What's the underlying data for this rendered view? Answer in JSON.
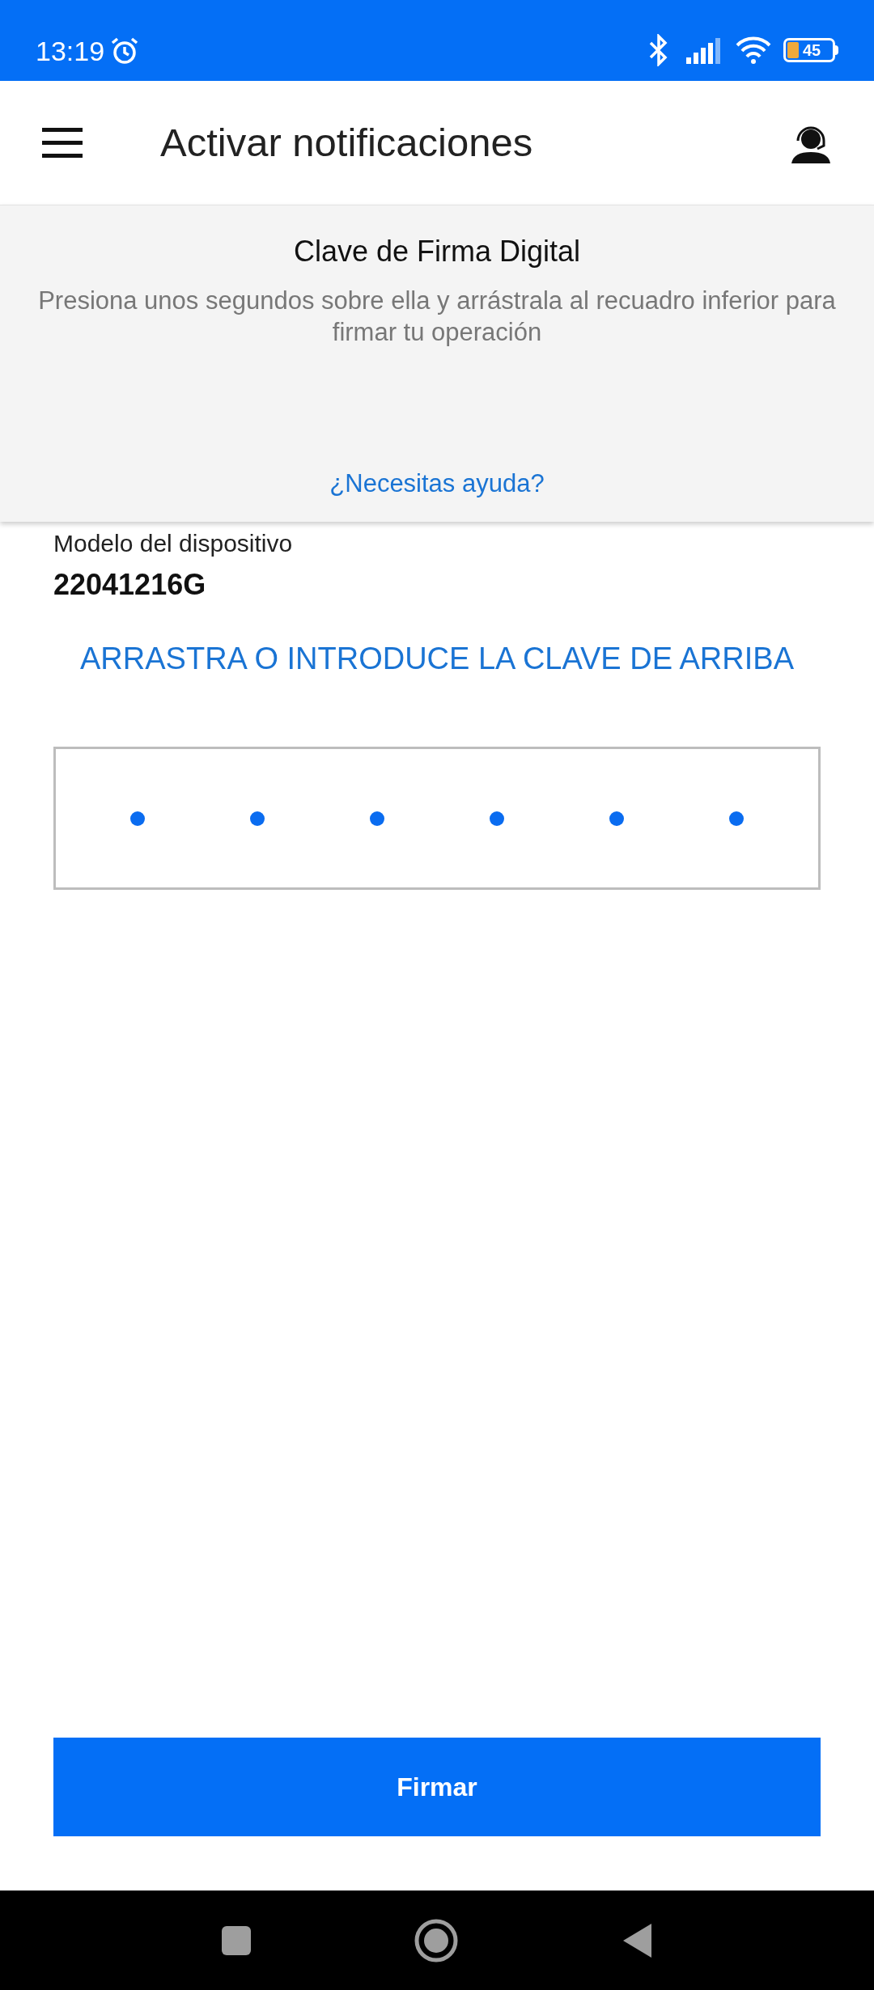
{
  "status_bar": {
    "time": "13:19",
    "battery": "45"
  },
  "app_bar": {
    "title": "Activar notificaciones"
  },
  "key_panel": {
    "title": "Clave de Firma Digital",
    "description": "Presiona unos segundos sobre ella y arrástrala al recuadro inferior para firmar tu operación",
    "help_link": "¿Necesitas ayuda?"
  },
  "device": {
    "label": "Modelo del dispositivo",
    "value": "22041216G"
  },
  "instruction": "ARRASTRA O INTRODUCE LA CLAVE DE ARRIBA",
  "key_box": {
    "slots": [
      {
        "kind": "empty"
      },
      {
        "kind": "empty"
      },
      {
        "kind": "empty"
      },
      {
        "kind": "empty"
      },
      {
        "kind": "empty"
      },
      {
        "kind": "empty"
      }
    ]
  },
  "button": "Firmar"
}
